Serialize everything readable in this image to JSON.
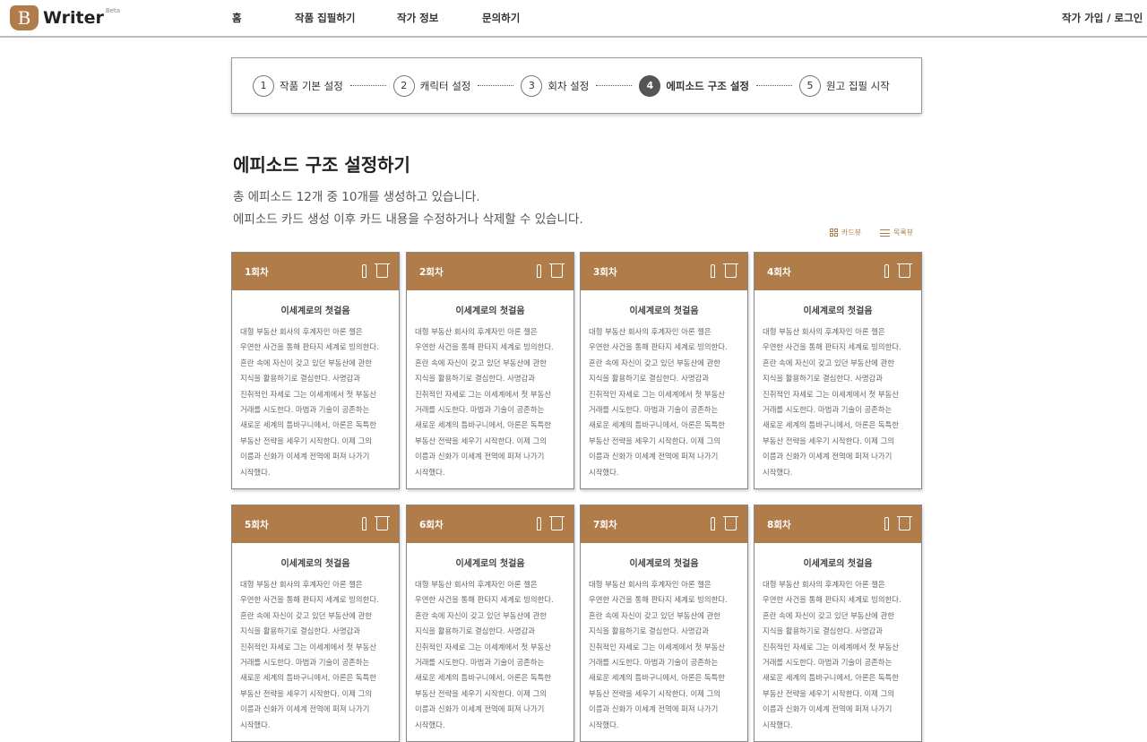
{
  "logo": {
    "letter": "B",
    "name": "Writer",
    "badge": "Beta"
  },
  "nav": {
    "items": [
      "홈",
      "작품 집필하기",
      "작가 정보",
      "문의하기"
    ],
    "auth": "작가 가입 / 로그인"
  },
  "steps": [
    {
      "num": "1",
      "label": "작품 기본 설정"
    },
    {
      "num": "2",
      "label": "캐릭터 설정"
    },
    {
      "num": "3",
      "label": "회차 설정"
    },
    {
      "num": "4",
      "label": "에피소드 구조 설정",
      "active": true
    },
    {
      "num": "5",
      "label": "원고 집필 시작"
    }
  ],
  "page": {
    "title": "에피소드 구조 설정하기",
    "desc1": "총 에피소드 12개 중 10개를 생성하고 있습니다.",
    "desc2": "에피소드 카드 생성 이후 카드 내용을 수정하거나 삭제할 수 있습니다.",
    "card_view": "카드뷰",
    "list_view": "목록뷰"
  },
  "accent": "#b07c4a",
  "cards": [
    {
      "episode": "1회차",
      "title": "이세계로의 첫걸음"
    },
    {
      "episode": "2회차",
      "title": "이세계로의 첫걸음"
    },
    {
      "episode": "3회차",
      "title": "이세계로의 첫걸음"
    },
    {
      "episode": "4회차",
      "title": "이세계로의 첫걸음"
    },
    {
      "episode": "5회차",
      "title": "이세계로의 첫걸음"
    },
    {
      "episode": "6회차",
      "title": "이세계로의 첫걸음"
    },
    {
      "episode": "7회차",
      "title": "이세계로의 첫걸음"
    },
    {
      "episode": "8회차",
      "title": "이세계로의 첫걸음"
    }
  ],
  "card_body_lines": [
    "대형 부동산 회사의 후계자인 아론 젤은",
    "우연한 사건을 통해 판타지 세계로 빙의한다.",
    "혼란 속에 자신이 갖고 있던 부동산에 관한",
    "지식을 활용하기로 결심한다. 사명감과",
    "진취적인 자세로 그는 이세계에서 첫 부동산",
    "거래를 시도한다. 마법과 기술이 공존하는",
    "새로운 세계의 틈바구니에서, 아론은 독특한",
    "부동산 전략을 세우기 시작한다. 이제 그의",
    "이름과 신화가 이세계 전역에 퍼져 나가기",
    "시작했다."
  ]
}
